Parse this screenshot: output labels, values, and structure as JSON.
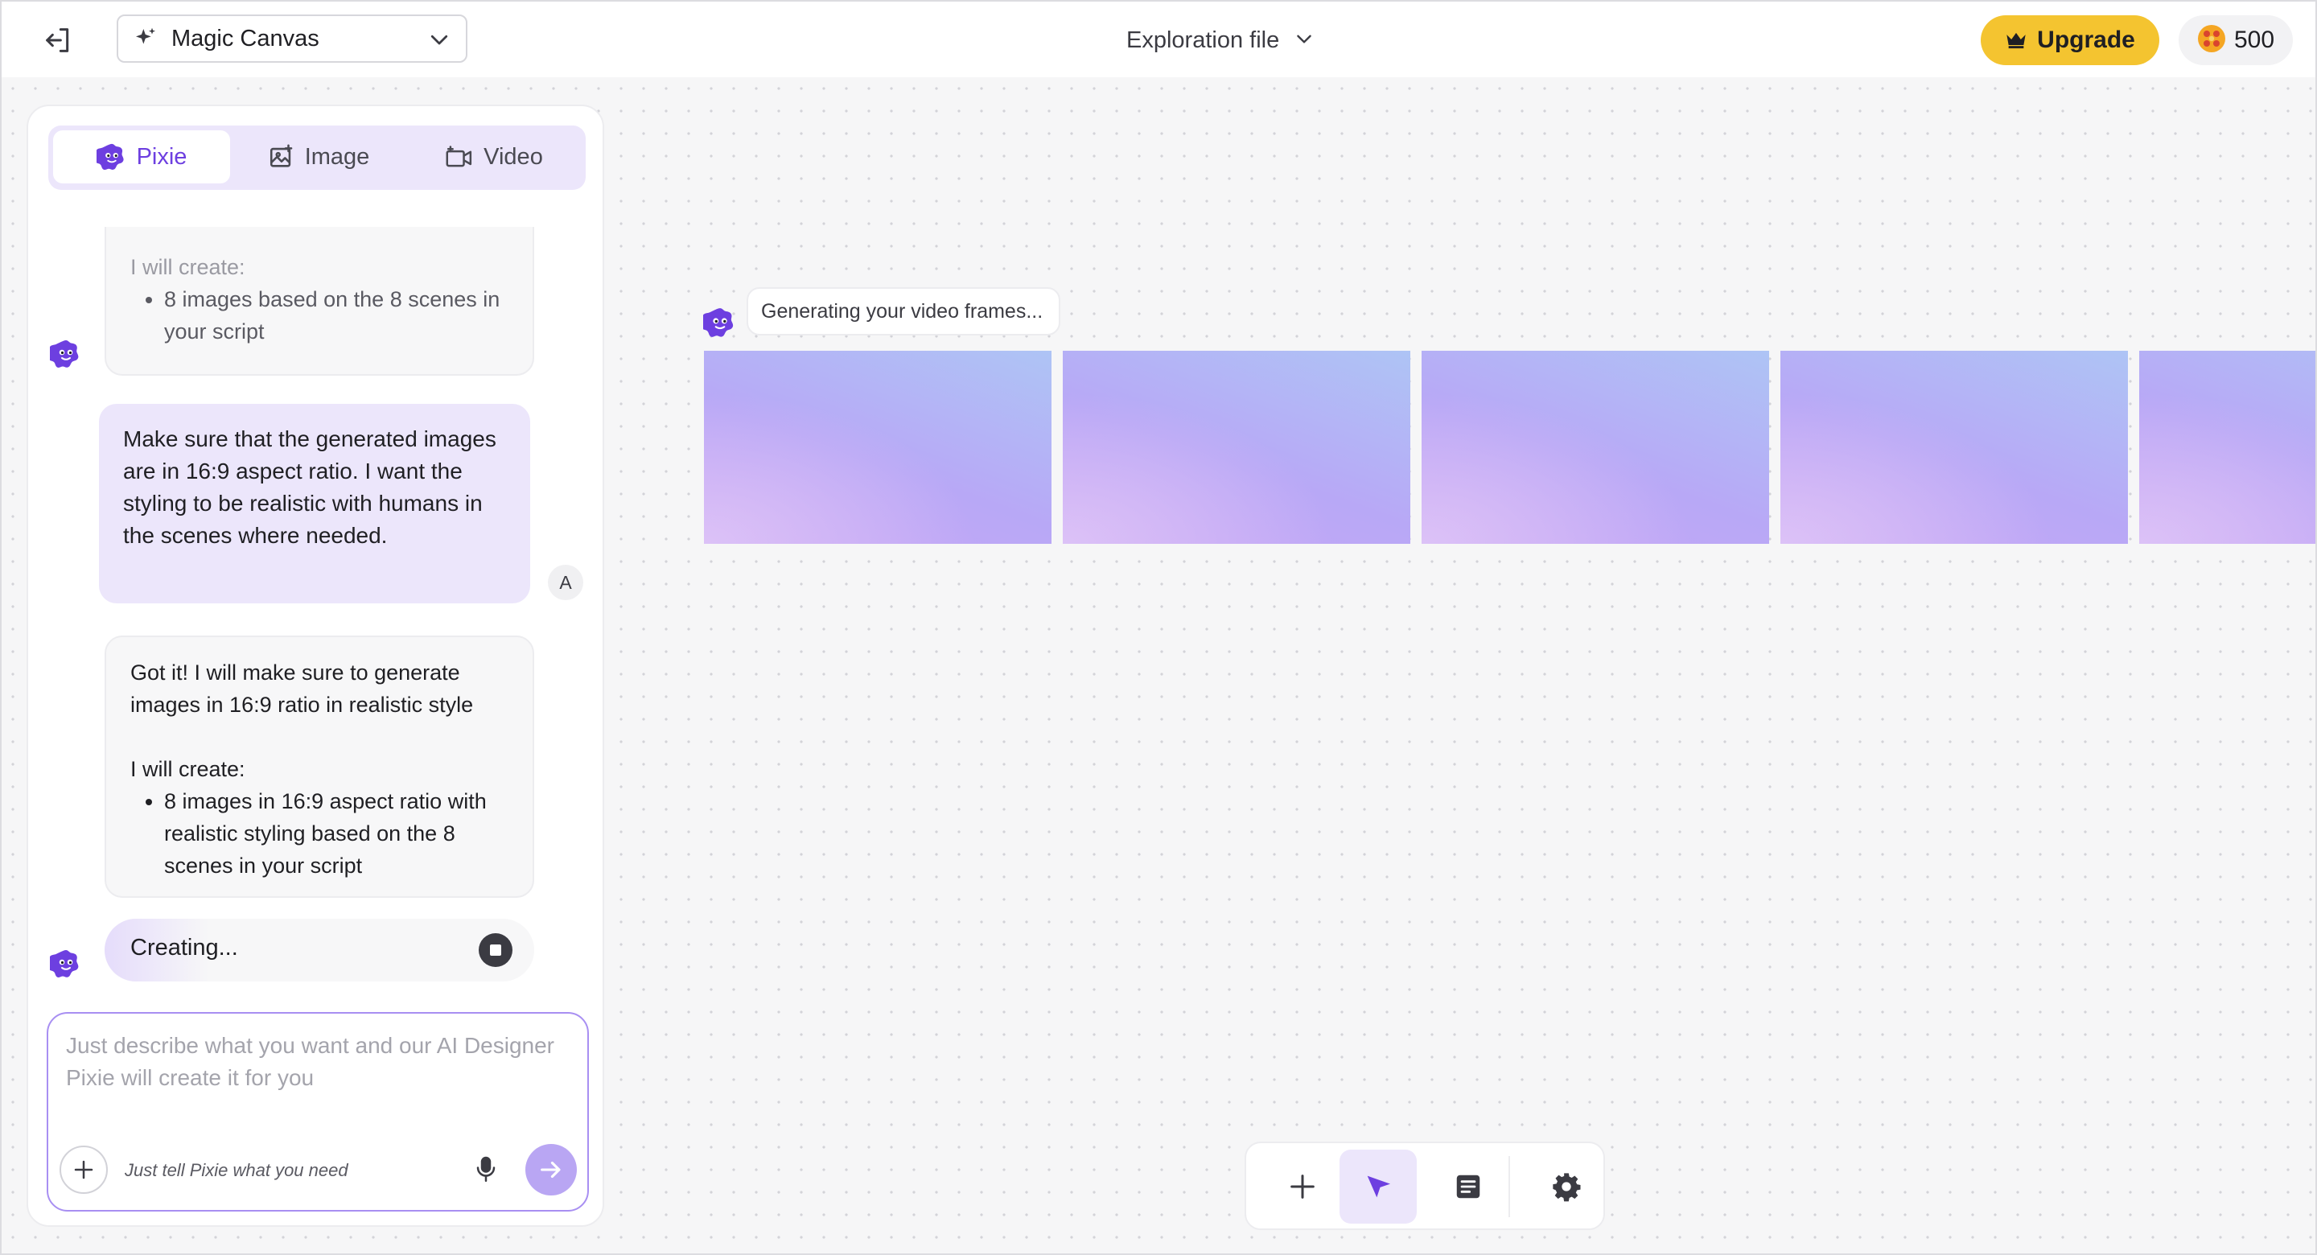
{
  "topbar": {
    "mode_label": "Magic Canvas",
    "file_title": "Exploration file",
    "upgrade_label": "Upgrade",
    "credits": "500"
  },
  "tabs": [
    {
      "label": "Pixie",
      "active": true
    },
    {
      "label": "Image",
      "active": false
    },
    {
      "label": "Video",
      "active": false
    }
  ],
  "chat": {
    "msg1": {
      "intro": "I will create:",
      "bullets": [
        "8 images based on the 8 scenes in your script"
      ]
    },
    "msg2": {
      "sender_initial": "A",
      "text": "Make sure that the generated images are in 16:9 aspect ratio. I want the styling to be realistic with humans in the scenes where needed."
    },
    "msg3": {
      "text": "Got it! I will make sure to generate images in 16:9 ratio in realistic style",
      "intro": "I will create:",
      "bullets": [
        "8 images in 16:9 aspect ratio with realistic styling based on the 8 scenes in your script"
      ]
    },
    "status": "Creating..."
  },
  "composer": {
    "placeholder": "Just describe what you want and our AI Designer Pixie will create it for you",
    "hint": "Just tell Pixie what you need"
  },
  "canvas": {
    "status": "Generating your video frames...",
    "frame_count": 5
  },
  "colors": {
    "accent": "#6d3fe0",
    "upgrade": "#f4c430",
    "tab_bg": "#ece6fb"
  },
  "icons": {
    "exit": "exit-icon",
    "sparkle": "sparkle-icon",
    "chevron": "chevron-down-icon",
    "crown": "crown-icon",
    "coin": "coin-icon",
    "bot": "pixie-bot-icon",
    "image": "image-icon",
    "video": "video-icon",
    "stop": "stop-icon",
    "plus": "plus-icon",
    "mic": "microphone-icon",
    "send": "arrow-right-icon",
    "cursor": "cursor-icon",
    "notes": "notes-icon",
    "gear": "gear-icon"
  }
}
